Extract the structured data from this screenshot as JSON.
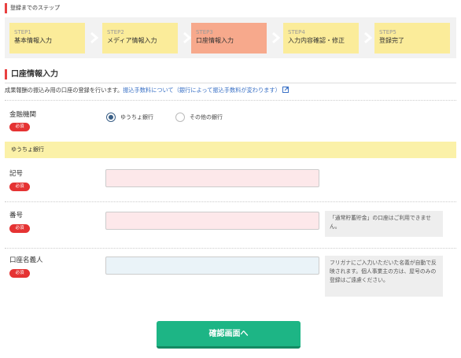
{
  "steps_header": "登録までのステップ",
  "steps": [
    {
      "num": "STEP1",
      "name": "基本情報入力",
      "active": false
    },
    {
      "num": "STEP2",
      "name": "メディア情報入力",
      "active": false
    },
    {
      "num": "STEP3",
      "name": "口座情報入力",
      "active": true
    },
    {
      "num": "STEP4",
      "name": "入力内容確認・修正",
      "active": false
    },
    {
      "num": "STEP5",
      "name": "登録完了",
      "active": false
    }
  ],
  "section": {
    "title": "口座情報入力",
    "desc_prefix": "成果報酬の振込み用の口座の登録を行います。",
    "desc_link": "振込手数料について（銀行によって振込手数料が変わります）"
  },
  "required_badge": "必須",
  "bank": {
    "label": "金融機関",
    "options": [
      {
        "label": "ゆうちょ銀行",
        "selected": true
      },
      {
        "label": "その他の銀行",
        "selected": false
      }
    ]
  },
  "band_title": "ゆうちょ銀行",
  "fields": {
    "kigou": {
      "label": "記号",
      "value": ""
    },
    "bangou": {
      "label": "番号",
      "value": "",
      "note": "「通常貯蓄貯金」の口座はご利用できません。"
    },
    "meigi": {
      "label": "口座名義人",
      "value": "",
      "note": "フリガナにご入力いただいた名義が自動で反映されます。個人事業主の方は、屋号のみの登録はご遠慮ください。"
    }
  },
  "submit_label": "確認画面へ",
  "colors": {
    "accent": "#e84040",
    "step": "#fbec9a",
    "step_active": "#f7a98c",
    "submit": "#1db585",
    "link": "#3a71c6"
  }
}
